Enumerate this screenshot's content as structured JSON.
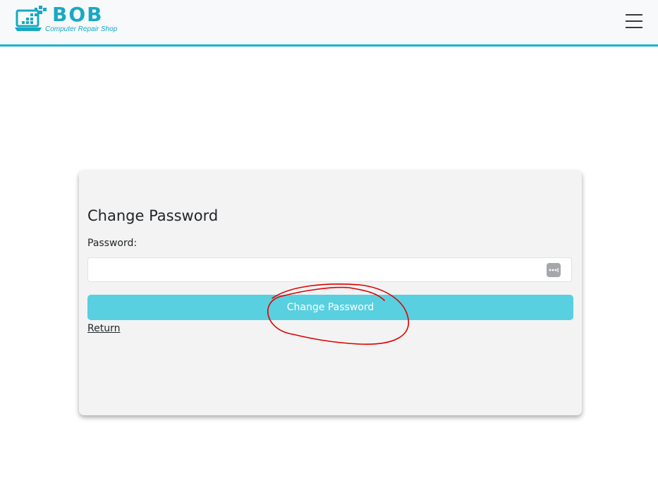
{
  "brand": {
    "title": "BOB",
    "subtitle": "Computer Repair Shop",
    "color": "#17a9c4"
  },
  "navbar": {
    "menu_icon": "hamburger-menu-icon",
    "border_color": "#17b3cf"
  },
  "form": {
    "title": "Change Password",
    "password_label": "Password:",
    "password_value": "",
    "password_manager_icon": "password-dots-icon",
    "submit_label": "Change Password",
    "submit_color": "#58d0e0",
    "return_label": "Return"
  },
  "annotation": {
    "shape": "hand-drawn circle",
    "color": "#e00000"
  }
}
